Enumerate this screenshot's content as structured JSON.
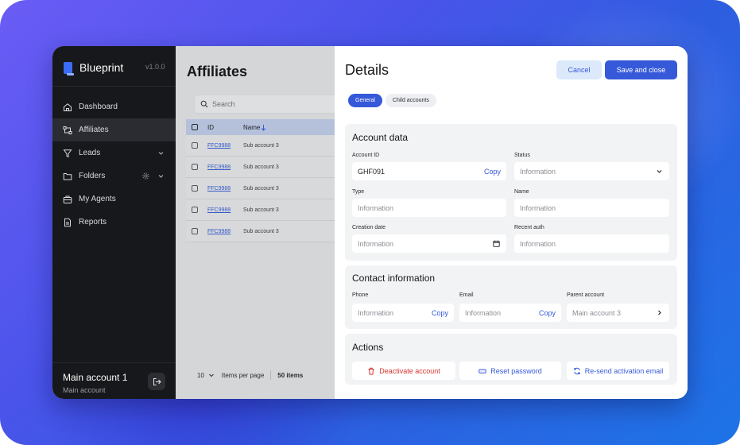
{
  "sidebar": {
    "brand": "Blueprint",
    "version": "v1.0.0",
    "items": [
      {
        "label": "Dashboard",
        "icon": "home-icon"
      },
      {
        "label": "Affiliates",
        "icon": "affiliates-icon",
        "active": true
      },
      {
        "label": "Leads",
        "icon": "filter-icon"
      },
      {
        "label": "Folders",
        "icon": "folder-icon"
      },
      {
        "label": "My Agents",
        "icon": "briefcase-icon"
      },
      {
        "label": "Reports",
        "icon": "document-icon"
      }
    ],
    "account": {
      "name": "Main account 1",
      "sub": "Main account"
    }
  },
  "main": {
    "title": "Affiliates",
    "search_placeholder": "Search",
    "columns": [
      "ID",
      "Name"
    ],
    "rows": [
      {
        "id": "FFC9988",
        "name": "Sub account 3"
      },
      {
        "id": "FFC9988",
        "name": "Sub account 3"
      },
      {
        "id": "FFC9988",
        "name": "Sub account 3"
      },
      {
        "id": "FFC9988",
        "name": "Sub account 3"
      },
      {
        "id": "FFC9988",
        "name": "Sub account 3"
      }
    ],
    "footer": {
      "page_size": "10",
      "page_size_label": "Items per page",
      "count": "50 items"
    }
  },
  "details": {
    "title": "Details",
    "cancel_label": "Cancel",
    "save_label": "Save and close",
    "tabs": [
      "General",
      "Child accounts"
    ],
    "account_data": {
      "title": "Account data",
      "account_id_label": "Account ID",
      "account_id_value": "GHF091",
      "copy_label": "Copy",
      "status_label": "Status",
      "status_value": "Information",
      "type_label": "Type",
      "type_value": "Information",
      "name_label": "Name",
      "name_value": "Information",
      "creation_date_label": "Creation date",
      "creation_date_value": "Information",
      "recent_auth_label": "Recent auth",
      "recent_auth_value": "Information"
    },
    "contact": {
      "title": "Contact information",
      "phone_label": "Phone",
      "phone_value": "Information",
      "email_label": "Email",
      "email_value": "Information",
      "parent_label": "Parent account",
      "parent_value": "Main account 3",
      "copy_label": "Copy"
    },
    "actions": {
      "title": "Actions",
      "deactivate_label": "Deactivate account",
      "reset_label": "Reset password",
      "resend_label": "Re-send activation email"
    }
  },
  "colors": {
    "accent": "#3559d9",
    "danger": "#d6322f",
    "sidebar_bg": "#17181b"
  }
}
